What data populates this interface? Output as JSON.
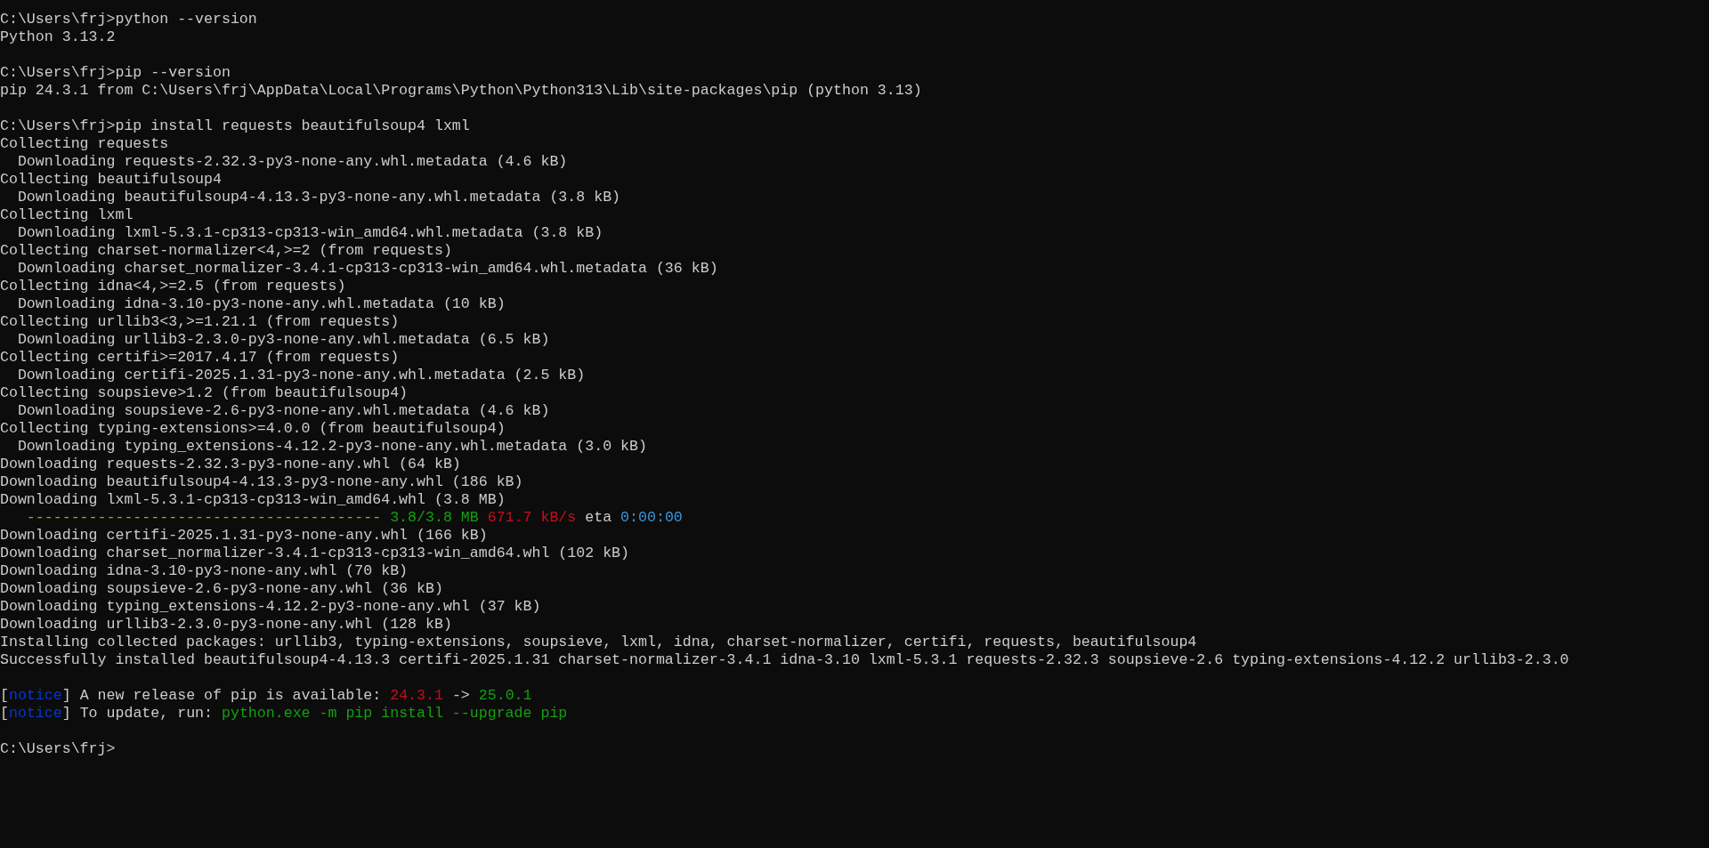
{
  "terminal": {
    "lines": [
      {
        "kind": "text",
        "segments": [
          {
            "text": "C:\\Users\\frj>python --version",
            "color": "#cccccc"
          }
        ]
      },
      {
        "kind": "text",
        "segments": [
          {
            "text": "Python 3.13.2",
            "color": "#cccccc"
          }
        ]
      },
      {
        "kind": "blank"
      },
      {
        "kind": "text",
        "segments": [
          {
            "text": "C:\\Users\\frj>pip --version",
            "color": "#cccccc"
          }
        ]
      },
      {
        "kind": "text",
        "segments": [
          {
            "text": "pip 24.3.1 from C:\\Users\\frj\\AppData\\Local\\Programs\\Python\\Python313\\Lib\\site-packages\\pip (python 3.13)",
            "color": "#cccccc"
          }
        ]
      },
      {
        "kind": "blank"
      },
      {
        "kind": "text",
        "segments": [
          {
            "text": "C:\\Users\\frj>pip install requests beautifulsoup4 lxml",
            "color": "#cccccc"
          }
        ]
      },
      {
        "kind": "text",
        "segments": [
          {
            "text": "Collecting requests",
            "color": "#cccccc"
          }
        ]
      },
      {
        "kind": "text",
        "segments": [
          {
            "text": "  Downloading requests-2.32.3-py3-none-any.whl.metadata (4.6 kB)",
            "color": "#cccccc"
          }
        ]
      },
      {
        "kind": "text",
        "segments": [
          {
            "text": "Collecting beautifulsoup4",
            "color": "#cccccc"
          }
        ]
      },
      {
        "kind": "text",
        "segments": [
          {
            "text": "  Downloading beautifulsoup4-4.13.3-py3-none-any.whl.metadata (3.8 kB)",
            "color": "#cccccc"
          }
        ]
      },
      {
        "kind": "text",
        "segments": [
          {
            "text": "Collecting lxml",
            "color": "#cccccc"
          }
        ]
      },
      {
        "kind": "text",
        "segments": [
          {
            "text": "  Downloading lxml-5.3.1-cp313-cp313-win_amd64.whl.metadata (3.8 kB)",
            "color": "#cccccc"
          }
        ]
      },
      {
        "kind": "text",
        "segments": [
          {
            "text": "Collecting charset-normalizer<4,>=2 (from requests)",
            "color": "#cccccc"
          }
        ]
      },
      {
        "kind": "text",
        "segments": [
          {
            "text": "  Downloading charset_normalizer-3.4.1-cp313-cp313-win_amd64.whl.metadata (36 kB)",
            "color": "#cccccc"
          }
        ]
      },
      {
        "kind": "text",
        "segments": [
          {
            "text": "Collecting idna<4,>=2.5 (from requests)",
            "color": "#cccccc"
          }
        ]
      },
      {
        "kind": "text",
        "segments": [
          {
            "text": "  Downloading idna-3.10-py3-none-any.whl.metadata (10 kB)",
            "color": "#cccccc"
          }
        ]
      },
      {
        "kind": "text",
        "segments": [
          {
            "text": "Collecting urllib3<3,>=1.21.1 (from requests)",
            "color": "#cccccc"
          }
        ]
      },
      {
        "kind": "text",
        "segments": [
          {
            "text": "  Downloading urllib3-2.3.0-py3-none-any.whl.metadata (6.5 kB)",
            "color": "#cccccc"
          }
        ]
      },
      {
        "kind": "text",
        "segments": [
          {
            "text": "Collecting certifi>=2017.4.17 (from requests)",
            "color": "#cccccc"
          }
        ]
      },
      {
        "kind": "text",
        "segments": [
          {
            "text": "  Downloading certifi-2025.1.31-py3-none-any.whl.metadata (2.5 kB)",
            "color": "#cccccc"
          }
        ]
      },
      {
        "kind": "text",
        "segments": [
          {
            "text": "Collecting soupsieve>1.2 (from beautifulsoup4)",
            "color": "#cccccc"
          }
        ]
      },
      {
        "kind": "text",
        "segments": [
          {
            "text": "  Downloading soupsieve-2.6-py3-none-any.whl.metadata (4.6 kB)",
            "color": "#cccccc"
          }
        ]
      },
      {
        "kind": "text",
        "segments": [
          {
            "text": "Collecting typing-extensions>=4.0.0 (from beautifulsoup4)",
            "color": "#cccccc"
          }
        ]
      },
      {
        "kind": "text",
        "segments": [
          {
            "text": "  Downloading typing_extensions-4.12.2-py3-none-any.whl.metadata (3.0 kB)",
            "color": "#cccccc"
          }
        ]
      },
      {
        "kind": "text",
        "segments": [
          {
            "text": "Downloading requests-2.32.3-py3-none-any.whl (64 kB)",
            "color": "#cccccc"
          }
        ]
      },
      {
        "kind": "text",
        "segments": [
          {
            "text": "Downloading beautifulsoup4-4.13.3-py3-none-any.whl (186 kB)",
            "color": "#cccccc"
          }
        ]
      },
      {
        "kind": "text",
        "segments": [
          {
            "text": "Downloading lxml-5.3.1-cp313-cp313-win_amd64.whl (3.8 MB)",
            "color": "#cccccc"
          }
        ]
      },
      {
        "kind": "progress",
        "segments": [
          {
            "text": "   ----------------------------------------",
            "color": "#c19c00"
          },
          {
            "text": " 3.8/3.8 MB",
            "color": "#13a10e"
          },
          {
            "text": " 671.7 kB/s",
            "color": "#c50f1f"
          },
          {
            "text": " eta",
            "color": "#cccccc"
          },
          {
            "text": " 0:00:00",
            "color": "#3a96dd"
          }
        ]
      },
      {
        "kind": "text",
        "segments": [
          {
            "text": "Downloading certifi-2025.1.31-py3-none-any.whl (166 kB)",
            "color": "#cccccc"
          }
        ]
      },
      {
        "kind": "text",
        "segments": [
          {
            "text": "Downloading charset_normalizer-3.4.1-cp313-cp313-win_amd64.whl (102 kB)",
            "color": "#cccccc"
          }
        ]
      },
      {
        "kind": "text",
        "segments": [
          {
            "text": "Downloading idna-3.10-py3-none-any.whl (70 kB)",
            "color": "#cccccc"
          }
        ]
      },
      {
        "kind": "text",
        "segments": [
          {
            "text": "Downloading soupsieve-2.6-py3-none-any.whl (36 kB)",
            "color": "#cccccc"
          }
        ]
      },
      {
        "kind": "text",
        "segments": [
          {
            "text": "Downloading typing_extensions-4.12.2-py3-none-any.whl (37 kB)",
            "color": "#cccccc"
          }
        ]
      },
      {
        "kind": "text",
        "segments": [
          {
            "text": "Downloading urllib3-2.3.0-py3-none-any.whl (128 kB)",
            "color": "#cccccc"
          }
        ]
      },
      {
        "kind": "text",
        "segments": [
          {
            "text": "Installing collected packages: urllib3, typing-extensions, soupsieve, lxml, idna, charset-normalizer, certifi, requests, beautifulsoup4",
            "color": "#cccccc"
          }
        ]
      },
      {
        "kind": "text",
        "segments": [
          {
            "text": "Successfully installed beautifulsoup4-4.13.3 certifi-2025.1.31 charset-normalizer-3.4.1 idna-3.10 lxml-5.3.1 requests-2.32.3 soupsieve-2.6 typing-extensions-4.12.2 urllib3-2.3.0",
            "color": "#cccccc"
          }
        ]
      },
      {
        "kind": "blank"
      },
      {
        "kind": "text",
        "segments": [
          {
            "text": "[",
            "color": "#cccccc"
          },
          {
            "text": "notice",
            "color": "#0037da"
          },
          {
            "text": "] A new release of pip is available: ",
            "color": "#cccccc"
          },
          {
            "text": "24.3.1",
            "color": "#c50f1f"
          },
          {
            "text": " -> ",
            "color": "#cccccc"
          },
          {
            "text": "25.0.1",
            "color": "#13a10e"
          }
        ]
      },
      {
        "kind": "text",
        "segments": [
          {
            "text": "[",
            "color": "#cccccc"
          },
          {
            "text": "notice",
            "color": "#0037da"
          },
          {
            "text": "] To update, run: ",
            "color": "#cccccc"
          },
          {
            "text": "python.exe -m pip install --upgrade pip",
            "color": "#13a10e"
          }
        ]
      },
      {
        "kind": "blank"
      },
      {
        "kind": "text",
        "segments": [
          {
            "text": "C:\\Users\\frj>",
            "color": "#cccccc"
          }
        ]
      }
    ]
  }
}
